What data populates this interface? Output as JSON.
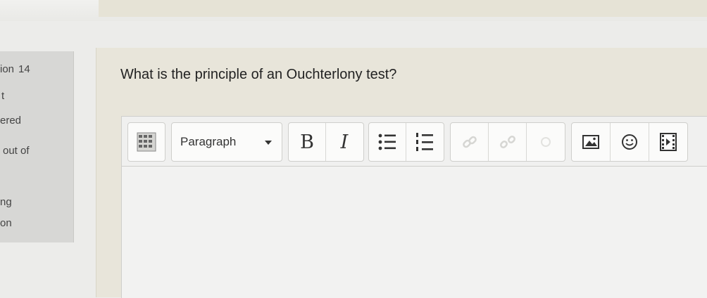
{
  "sidebar": {
    "question_label": "ion",
    "question_number": "14",
    "line1": "t",
    "line2": "ered",
    "line3": "out of",
    "line4": "ng",
    "line5": "on"
  },
  "question": {
    "text": "What is the principle of an Ouchterlony test?"
  },
  "toolbar": {
    "paragraph_select": "Paragraph",
    "bold_label": "B",
    "italic_label": "I",
    "icons": [
      "toolbar-toggle-icon",
      "bold-icon",
      "italic-icon",
      "unordered-list-icon",
      "ordered-list-icon",
      "link-icon",
      "unlink-icon",
      "disabled-icon",
      "image-icon",
      "emoticon-icon",
      "media-icon"
    ]
  }
}
